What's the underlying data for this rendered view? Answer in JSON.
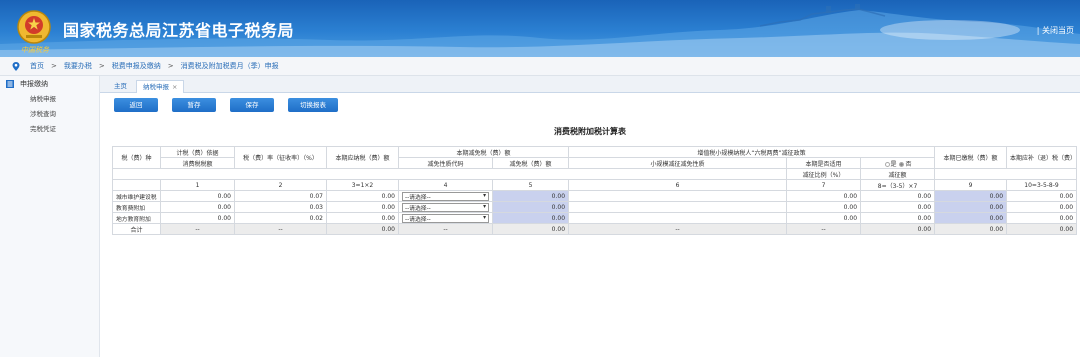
{
  "header": {
    "title": "国家税务总局江苏省电子税务局",
    "logo_text": "中国税务",
    "close_label": "| 关闭当页"
  },
  "breadcrumb": [
    "首页",
    "我要办税",
    "税费申报及缴纳",
    "消费税及附加税费月（季）申报"
  ],
  "sidebar": {
    "heading": "申报缴纳",
    "items": [
      "纳税申报",
      "涉税查询",
      "完税凭证"
    ]
  },
  "tabs": {
    "home": "主页",
    "active": "纳税申报",
    "close": "×"
  },
  "toolbar": {
    "back": "返回",
    "save_draft": "暂存",
    "save": "保存",
    "switch": "切换报表"
  },
  "table": {
    "title": "消费税附加税计算表",
    "headers": {
      "tax_kind": "税（费）种",
      "basis_group": "计税（费）依据",
      "consumption_tax": "消费税税额",
      "rate": "税（费）率（征收率）（%）",
      "payable": "本期应纳税（费）额",
      "relief_group": "本期减免税（费）额",
      "relief_code": "减免性质代码",
      "relief_amount": "减免税（费）额",
      "six_group": "增值税小规模纳税人“六税两费”减征政策",
      "small_code": "小规模减征减免性质",
      "applies": "本期是否适用",
      "yes": "是",
      "no": "否",
      "reduce_ratio": "减征比例（%）",
      "reduce_amount": "减征额",
      "paid": "本期已缴税（费）额",
      "refund": "本期应补（退）税（费）额"
    },
    "col_numbers": [
      "1",
      "2",
      "3=1×2",
      "4",
      "5",
      "6",
      "7",
      "8=（3-5）×7",
      "9",
      "10=3-5-8-9"
    ],
    "rows": [
      {
        "name": "城市维护建设税",
        "basis": "0.00",
        "rate": "0.07",
        "payable": "0.00",
        "select": "--请选择--",
        "relief": "0.00",
        "ratio": "0.00",
        "reduce": "0.00",
        "paid": "0.00",
        "refund": "0.00"
      },
      {
        "name": "教育费附加",
        "basis": "0.00",
        "rate": "0.03",
        "payable": "0.00",
        "select": "--请选择--",
        "relief": "0.00",
        "ratio": "0.00",
        "reduce": "0.00",
        "paid": "0.00",
        "refund": "0.00"
      },
      {
        "name": "地方教育附加",
        "basis": "0.00",
        "rate": "0.02",
        "payable": "0.00",
        "select": "--请选择--",
        "relief": "0.00",
        "ratio": "0.00",
        "reduce": "0.00",
        "paid": "0.00",
        "refund": "0.00"
      }
    ],
    "total": {
      "name": "合计",
      "dash": "--",
      "payable": "0.00",
      "relief": "0.00",
      "reduce": "0.00",
      "paid": "0.00",
      "refund": "0.00"
    }
  },
  "colors": {
    "header_blue": "#2b80d2",
    "button_blue": "#1f6ec7",
    "cell_grey": "#ececec",
    "cell_blue": "#c9d1ee"
  }
}
